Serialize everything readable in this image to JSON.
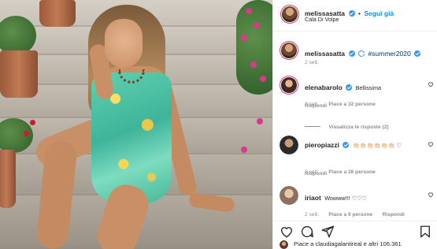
{
  "post": {
    "author": "melissasatta",
    "follow_label": "Segui già",
    "separator": "•",
    "location": "Cala Di Volpe"
  },
  "caption": {
    "username": "melissasatta",
    "text": "#summer2020",
    "time": "2 sett."
  },
  "comments": [
    {
      "username": "elenabarolo",
      "text": "Bellissima",
      "time": "2 sett.",
      "likes": "Piace a 32 persone",
      "reply": "Rispondi",
      "view_replies": "Visualizza le risposte (2)"
    },
    {
      "username": "pieropiazzi",
      "text": "👏🏻👏🏻👏🏻👏🏻👏🏻👏🏻 ♡",
      "time": "2 sett.",
      "likes": "Piace a 26 persone",
      "reply": "Rispondi"
    },
    {
      "username": "iriaot",
      "text": "Wowww!!! ♡♡♡",
      "time": "2 sett.",
      "likes": "Piace a 9 persone",
      "reply": "Rispondi"
    }
  ],
  "liked_by": "Piace a claudiagalantireal e altri 106.361",
  "icons": {
    "verified": "verified-badge-icon",
    "like": "heart-icon",
    "comment": "comment-icon",
    "share": "paper-plane-icon",
    "save": "bookmark-icon"
  },
  "colors": {
    "accent": "#0095f6",
    "verified": "#3897f0",
    "muted_text": "#8e8e8e",
    "story_ring": "#d43c7c"
  }
}
